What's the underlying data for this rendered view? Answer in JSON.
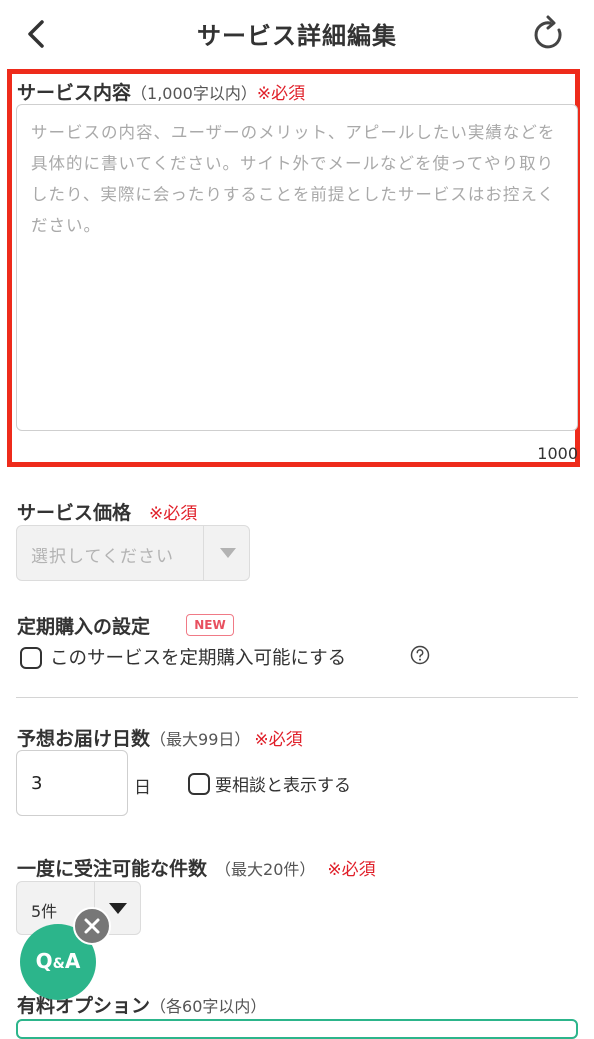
{
  "header": {
    "title": "サービス詳細編集"
  },
  "service_content": {
    "label": "サービス内容",
    "limit_note": "（1,000字以内）",
    "required": "※必須",
    "placeholder": "サービスの内容、ユーザーのメリット、アピールしたい実績などを具体的に書いてください。サイト外でメールなどを使ってやり取りしたり、実際に会ったりすることを前提としたサービスはお控えください。",
    "counter": "1000"
  },
  "price": {
    "label": "サービス価格",
    "required": "※必須",
    "placeholder": "選択してください"
  },
  "subscription": {
    "label": "定期購入の設定",
    "badge": "NEW",
    "checkbox_label": "このサービスを定期購入可能にする"
  },
  "delivery": {
    "label": "予想お届け日数",
    "limit_note": "（最大99日）",
    "required": "※必須",
    "value": "3",
    "unit": "日",
    "consult_label": "要相談と表示する"
  },
  "capacity": {
    "label": "一度に受注可能な件数",
    "limit_note": "（最大20件）",
    "required": "※必須",
    "value": "5件"
  },
  "qa": {
    "label_q": "Q",
    "label_amp": "&",
    "label_a": "A"
  },
  "options": {
    "label": "有料オプション",
    "limit_note": "（各60字以内）"
  },
  "colors": {
    "highlight": "#ee2b1b",
    "required": "#e0202a",
    "accent": "#2cb58b",
    "badge": "#e8505f"
  }
}
